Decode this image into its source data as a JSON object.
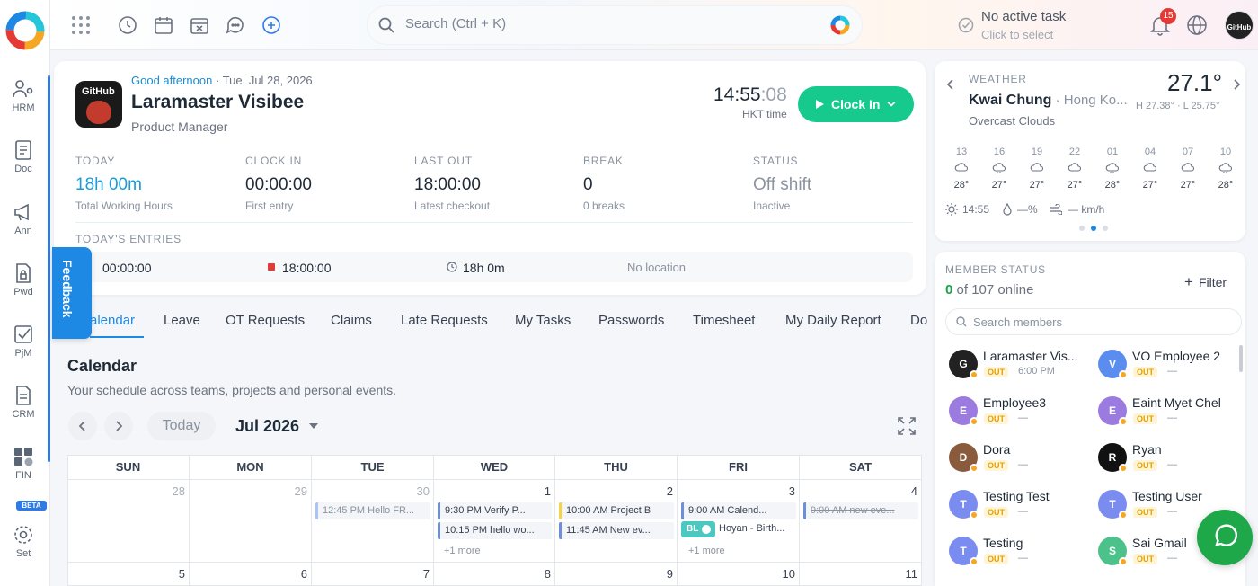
{
  "sidebar": {
    "items": [
      {
        "label": "HRM"
      },
      {
        "label": "Doc"
      },
      {
        "label": "Ann"
      },
      {
        "label": "Pwd"
      },
      {
        "label": "PjM"
      },
      {
        "label": "CRM"
      },
      {
        "label": "FIN"
      },
      {
        "label": "Set"
      }
    ],
    "beta": "BETA"
  },
  "topbar": {
    "search_placeholder": "Search (Ctrl + K)",
    "task_title": "No active task",
    "task_sub": "Click to select",
    "notif_count": "15"
  },
  "profile": {
    "greeting": "Good afternoon",
    "date": " · Tue, Jul 28, 2026",
    "name": "Laramaster Visibee",
    "role": "Product Manager",
    "time_hm": "14:55",
    "time_s": ":08",
    "tz": "HKT time",
    "clock_in": "Clock In",
    "avatar_text": "GitHub"
  },
  "stats": [
    {
      "label": "TODAY",
      "value": "18h 00m",
      "sub": "Total Working Hours"
    },
    {
      "label": "CLOCK IN",
      "value": "00:00:00",
      "sub": "First entry"
    },
    {
      "label": "LAST OUT",
      "value": "18:00:00",
      "sub": "Latest checkout"
    },
    {
      "label": "BREAK",
      "value": "0",
      "sub": "0 breaks"
    },
    {
      "label": "STATUS",
      "value": "Off shift",
      "sub": "Inactive"
    }
  ],
  "entries": {
    "label": "TODAY'S ENTRIES",
    "in": "00:00:00",
    "out": "18:00:00",
    "duration": "18h 0m",
    "location": "No location"
  },
  "feedback": "Feedback",
  "tabs": [
    "alendar",
    "Leave",
    "OT Requests",
    "Claims",
    "Late Requests",
    "My Tasks",
    "Passwords",
    "Timesheet",
    "My Daily Report",
    "Do"
  ],
  "calendar": {
    "title": "Calendar",
    "subtitle": "Your schedule across teams, projects and personal events.",
    "today": "Today",
    "month": "Jul 2026",
    "days": [
      "SUN",
      "MON",
      "TUE",
      "WED",
      "THU",
      "FRI",
      "SAT"
    ],
    "week1": [
      "28",
      "29",
      "30",
      "1",
      "2",
      "3",
      "4"
    ],
    "week2": [
      "5",
      "6",
      "7",
      "8",
      "9",
      "10",
      "11"
    ],
    "events": {
      "tue": "12:45 PM  Hello FR...",
      "wed1": "9:30 PM  Verify P...",
      "wed2": "10:15 PM  hello wo...",
      "wed_more": "+1 more",
      "thu1": "10:00 AM  Project B",
      "thu2": "11:45 AM  New ev...",
      "fri1": "9:00 AM  Calend...",
      "fri2_tag": "BL",
      "fri2": "Hoyan - Birth...",
      "fri_more": "+1 more",
      "sat1": "9:00 AM  new eve..."
    }
  },
  "weather": {
    "label": "WEATHER",
    "city": "Kwai Chung",
    "region": " · Hong Ko...",
    "desc": "Overcast Clouds",
    "temp": "27.1°",
    "hl": "H 27.38° · L 25.75°",
    "hours": [
      "13",
      "16",
      "19",
      "22",
      "01",
      "04",
      "07",
      "10"
    ],
    "temps": [
      "28°",
      "27°",
      "27°",
      "27°",
      "28°",
      "27°",
      "27°",
      "28°"
    ],
    "sunrise": "14:55",
    "humidity": "—%",
    "wind": "— km/h"
  },
  "members": {
    "label": "MEMBER STATUS",
    "online": "0",
    "total": " of 107 online",
    "filter": "Filter",
    "search_placeholder": "Search members",
    "out": "OUT",
    "list": [
      {
        "name": "Laramaster Vis...",
        "time": "6:00 PM",
        "initial": "G",
        "color": "#222222"
      },
      {
        "name": "VO Employee 2",
        "time": "—",
        "initial": "V",
        "color": "#5b8def"
      },
      {
        "name": "Employee3",
        "time": "—",
        "initial": "E",
        "color": "#9b7be0"
      },
      {
        "name": "Eaint Myet Chel",
        "time": "—",
        "initial": "E",
        "color": "#9b7be0"
      },
      {
        "name": "Dora",
        "time": "—",
        "initial": "D",
        "color": "#8a5a3c"
      },
      {
        "name": "Ryan",
        "time": "—",
        "initial": "R",
        "color": "#111111"
      },
      {
        "name": "Testing Test",
        "time": "—",
        "initial": "T",
        "color": "#7b8cf0"
      },
      {
        "name": "Testing User",
        "time": "—",
        "initial": "T",
        "color": "#7b8cf0"
      },
      {
        "name": "Testing",
        "time": "—",
        "initial": "T",
        "color": "#7b8cf0"
      },
      {
        "name": "Sai Gmail",
        "time": "—",
        "initial": "S",
        "color": "#4cc28a"
      }
    ]
  }
}
